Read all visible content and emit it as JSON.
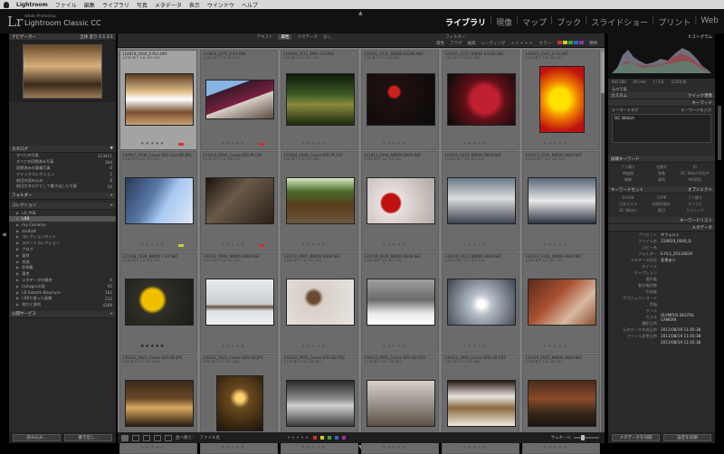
{
  "menubar": {
    "app": "Lightroom",
    "items": [
      "ファイル",
      "編集",
      "ライブラリ",
      "写真",
      "メタデータ",
      "表示",
      "ウインドウ",
      "ヘルプ"
    ]
  },
  "identity": {
    "logo": "Lr",
    "adobe": "Adobe Photoshop",
    "product": "Lightroom Classic CC"
  },
  "modules": [
    {
      "label": "ライブラリ",
      "active": true
    },
    {
      "label": "現像"
    },
    {
      "label": "マップ"
    },
    {
      "label": "ブック"
    },
    {
      "label": "スライドショー"
    },
    {
      "label": "プリント"
    },
    {
      "label": "Web"
    }
  ],
  "left": {
    "navigator": {
      "title": "ナビゲーター",
      "zoom": "全体  塗り  1:1  3:1"
    },
    "catalog": {
      "title": "カタログ",
      "items": [
        {
          "label": "すべての写真",
          "count": "213411"
        },
        {
          "label": "すべての同期済み写真",
          "count": "344"
        },
        {
          "label": "同期済みの重複写真",
          "count": "0"
        },
        {
          "label": "クイックコレクション",
          "count": "1"
        },
        {
          "label": "前回の読み込み",
          "count": "8"
        },
        {
          "label": "前回カタログとして書き出した写真",
          "count": "10"
        }
      ]
    },
    "folders": {
      "title": "フォルダー"
    },
    "collections": {
      "title": "コレクション",
      "items": [
        {
          "label": "LR_PS8",
          "count": ""
        },
        {
          "label": "LR8",
          "count": "",
          "selected": true
        },
        {
          "label": "my Cameras",
          "count": ""
        },
        {
          "label": "studio9",
          "count": ""
        },
        {
          "label": "コレクションセット",
          "count": ""
        },
        {
          "label": "スマートコレクション",
          "count": ""
        },
        {
          "label": "ブログ",
          "count": ""
        },
        {
          "label": "東京",
          "count": ""
        },
        {
          "label": "合成",
          "count": ""
        },
        {
          "label": "作例集",
          "count": ""
        },
        {
          "label": "東京",
          "count": ""
        },
        {
          "label": "メタデータの競合",
          "count": "0"
        },
        {
          "label": "Instagram用",
          "count": "45"
        },
        {
          "label": "LR Satoshi Kitamura",
          "count": "162"
        },
        {
          "label": "LR8で使った画像",
          "count": "232"
        },
        {
          "label": "何かと便利",
          "count": "4189"
        }
      ]
    },
    "publish": {
      "title": "公開サービス"
    },
    "buttons": {
      "import": "読み込み...",
      "export": "書き出し..."
    }
  },
  "filter": {
    "tabs": [
      "テキスト",
      "属性",
      "メタデータ",
      "なし"
    ],
    "active": "属性",
    "label_attr": "属性",
    "label_flag": "フラグ",
    "label_edit": "編集",
    "label_rating": "レーティング",
    "label_color": "カラー",
    "label_kind": "種類",
    "preset": "フィルター"
  },
  "thumbs": [
    {
      "name": "110819_0040_E-PL3.ORF",
      "meta": "1/250 秒 F 5.6, ISO 200",
      "selected": true,
      "photo": "lantern",
      "stars": 0,
      "label": "#c33"
    },
    {
      "name": "110819_0276_E-P3.ORF",
      "meta": "1/100 秒 F 2.0, ISO 200",
      "photo": "soul",
      "stars": 0,
      "label": "#c33"
    },
    {
      "name": "110910_0512_DMC-G3.RW2",
      "meta": "1/80 秒 F 4.0, ISO 200",
      "photo": "forest",
      "stars": 0,
      "label": ""
    },
    {
      "name": "120531_0122_NIKON D3200.NEF",
      "meta": "1/60 秒 F 5.6, ISO 800",
      "photo": "redflower",
      "stars": 0,
      "label": ""
    },
    {
      "name": "120531_0127_NIKON D3200.NEF",
      "meta": "1/60 秒 F 5.6, ISO 800",
      "photo": "redleaves",
      "stars": 0,
      "label": ""
    },
    {
      "name": "120625_0143_E-P3.ORF",
      "meta": "1/320 秒 F 2.8, ISO 200",
      "photo": "yellowflower",
      "stars": 0,
      "label": ""
    },
    {
      "name": "120907_0708_Canon EOS Kiss X6i.JPG",
      "meta": "1/160 秒 F 8.0, ISO 100",
      "photo": "building",
      "stars": 0,
      "label": "#cc3"
    },
    {
      "name": "121004_0264_Canon EOS M.CR2",
      "meta": "1/125 秒 F 2.0, ISO 100",
      "photo": "shadow",
      "stars": 0,
      "label": "#c33"
    },
    {
      "name": "121004_0360_Canon EOS M.CR2",
      "meta": "1/80 秒 F 2.8, ISO 400",
      "photo": "colonnade",
      "stars": 0,
      "label": ""
    },
    {
      "name": "121012_0194_NIKON D600.NEF",
      "meta": "1/400 秒 F 5.6, ISO 100",
      "photo": "maple",
      "stars": 0,
      "label": ""
    },
    {
      "name": "121012_0223_NIKON D600.NEF",
      "meta": "1/1000 秒 F 5.6, ISO 100",
      "photo": "clouds",
      "stars": 0,
      "label": ""
    },
    {
      "name": "121012_0225_NIKON D600.NEF",
      "meta": "1/1000 秒 F 5.6, ISO 100",
      "photo": "clouds2",
      "stars": 0,
      "label": ""
    },
    {
      "name": "121108_0228_NIKON 1 V2.NEF",
      "meta": "1/160 秒 F 4.0, ISO 160",
      "photo": "yellowleaf",
      "stars": 5,
      "label": ""
    },
    {
      "name": "130110_0004_NIKON D600.NEF",
      "meta": "1/500 秒 F 5.6, ISO 100",
      "photo": "snowtwig",
      "stars": 0,
      "label": ""
    },
    {
      "name": "130110_0007_NIKON D600.NEF",
      "meta": "1/500 秒 F 5.6, ISO 100",
      "photo": "dryplant",
      "stars": 0,
      "label": ""
    },
    {
      "name": "130110_0024_NIKON D600.NEF",
      "meta": "1/640 秒 F 5.6, ISO 100",
      "photo": "winterwood",
      "stars": 0,
      "label": ""
    },
    {
      "name": "130110_0112_NIKON D600.NEF",
      "meta": "1/2000 秒 F 8.0, ISO 100",
      "photo": "sunclouds",
      "stars": 0,
      "label": ""
    },
    {
      "name": "130110_0118_NIKON D600.NEF",
      "meta": "1/200 秒 F 4.0, ISO 100",
      "photo": "bar",
      "stars": 0,
      "label": ""
    },
    {
      "name": "130312_0021_Canon EOS 6D.JPG",
      "meta": "1/60 秒 F 4.0, ISO 1600",
      "photo": "church",
      "stars": 0,
      "label": ""
    },
    {
      "name": "130312_0023_Canon EOS 6D.JPG",
      "meta": "1/60 秒 F 4.0, ISO 1600",
      "photo": "lamps",
      "stars": 0,
      "label": ""
    },
    {
      "name": "130312_0055_Canon EOS 6D.CR2",
      "meta": "1/125 秒 F 4.0, ISO 400",
      "photo": "window",
      "stars": 0,
      "label": ""
    },
    {
      "name": "130312_0061_Canon EOS 6D.CR2",
      "meta": "1/125 秒 F 4.0, ISO 400",
      "photo": "interior",
      "stars": 0,
      "label": ""
    },
    {
      "name": "130312_0065_Canon EOS 6D.CR2",
      "meta": "1/60 秒 F 4.0, ISO 800",
      "photo": "shelf",
      "stars": 0,
      "label": ""
    },
    {
      "name": "130319_0025_NIKON D600.NEF",
      "meta": "1/160 秒 F 5.6, ISO 200",
      "photo": "brick",
      "stars": 0,
      "label": ""
    }
  ],
  "toolbar": {
    "sort_label": "並べ替え：",
    "sort_value": "ファイル名",
    "thumb_label": "サムネール"
  },
  "right": {
    "histogram": {
      "title": "ヒストグラム",
      "iso": "ISO 200",
      "focal": "45 mm",
      "aperture": "f / 5.6",
      "shutter": "1/250 秒",
      "original": "元の写真"
    },
    "quick": {
      "title": "クイック現像",
      "preset": "カスタム"
    },
    "keywords": {
      "title": "キーワード",
      "tag_label": "キーワードタグ",
      "tag_mode": "キーワードを入力",
      "value": "DC Watch"
    },
    "suggest": {
      "title": "候補キーワード",
      "items": [
        "ブリ撮り",
        "名樹木",
        "JR",
        "時価版",
        "発着",
        "DC Watch予告中",
        "開催",
        "車両",
        "NO初回"
      ]
    },
    "kwset": {
      "title": "キーワードセット",
      "mode": "オブジェクト",
      "items": [
        "D-CAN",
        "CAPK",
        "ブリ撮り",
        "日本カメラ",
        "技術評論社",
        "マイナビ",
        "DC Watch",
        "朝日",
        "クリニック"
      ]
    },
    "kwlist": {
      "title": "キーワードリスト"
    },
    "metadata": {
      "title": "メタデータ",
      "preset": "デフォルト",
      "preset_label": "プリセット",
      "rows": [
        {
          "label": "ファイル名",
          "value": "110819_0040_E-"
        },
        {
          "label": "コピー名",
          "value": ""
        },
        {
          "label": "フォルダー",
          "value": "E-PL3_20110819"
        },
        {
          "label": "メタデータ状況",
          "value": "変更あり"
        },
        {
          "label": "タイトル",
          "value": ""
        },
        {
          "label": "キャプション",
          "value": ""
        },
        {
          "label": "著作権",
          "value": ""
        },
        {
          "label": "著作権状態",
          "value": ""
        },
        {
          "label": "作成者",
          "value": ""
        },
        {
          "label": "サブジェクトコード",
          "value": ""
        },
        {
          "label": "評価",
          "value": ""
        },
        {
          "label": "ラベル",
          "value": ""
        },
        {
          "label": "カメラ",
          "value": "OLYMPUS DIGITAL CAMERA"
        },
        {
          "label": "撮影日時",
          "value": ""
        },
        {
          "label": "元のデータ作成日時",
          "value": "2011/08/19 11:45:38"
        },
        {
          "label": "ファイル変更日時",
          "value": "2011/08/19 11:45:38"
        },
        {
          "label": "",
          "value": "2011/08/19 11:45:38"
        }
      ]
    },
    "buttons": {
      "sync_meta": "メタデータを同期",
      "sync_settings": "設定を同期"
    }
  }
}
